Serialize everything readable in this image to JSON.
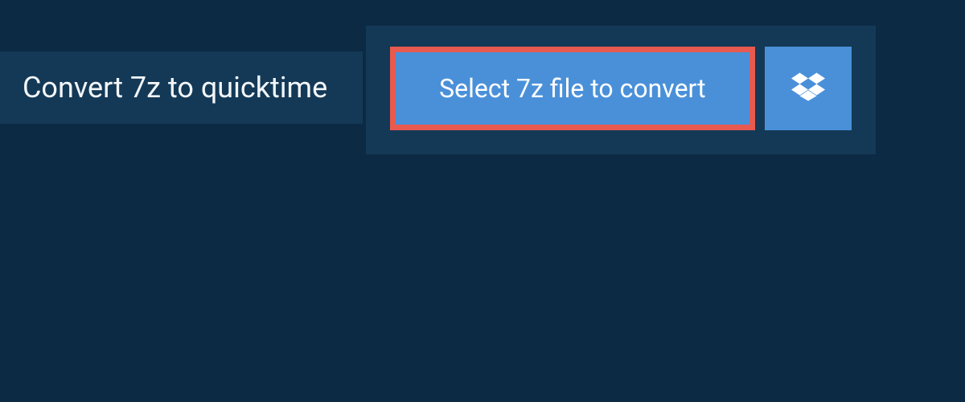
{
  "title": "Convert 7z to quicktime",
  "buttons": {
    "select_label": "Select 7z file to convert"
  },
  "colors": {
    "background": "#0c2a44",
    "panel": "#143956",
    "button": "#4a90d9",
    "highlight_border": "#e85a4f",
    "text_light": "#f2f6fa"
  },
  "icons": {
    "dropbox": "dropbox-icon"
  }
}
